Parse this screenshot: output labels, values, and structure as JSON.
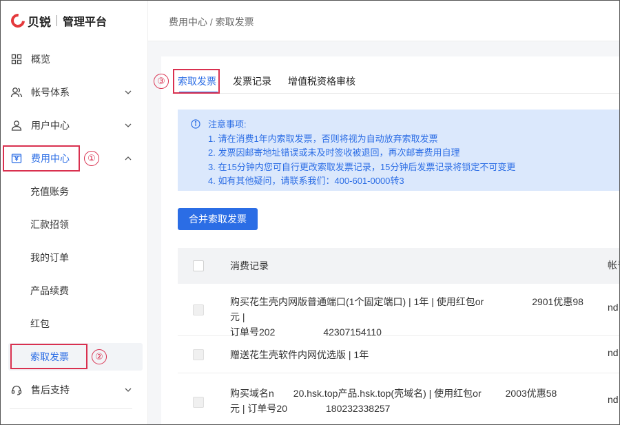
{
  "logo": {
    "brand": "贝锐",
    "title": "管理平台"
  },
  "sidebar": {
    "items": [
      {
        "label": "概览",
        "icon": "grid-icon"
      },
      {
        "label": "帐号体系",
        "icon": "users-icon"
      },
      {
        "label": "用户中心",
        "icon": "user-icon"
      },
      {
        "label": "费用中心",
        "icon": "yen-ledger-icon"
      },
      {
        "label": "售后支持",
        "icon": "headset-icon"
      }
    ],
    "sub_items": [
      "充值账务",
      "汇款招领",
      "我的订单",
      "产品续费",
      "红包",
      "索取发票"
    ]
  },
  "annotations": {
    "one": "①",
    "two": "②",
    "three": "③"
  },
  "breadcrumb": "费用中心 / 索取发票",
  "tabs": [
    "索取发票",
    "发票记录",
    "增值税资格审核"
  ],
  "notice": {
    "title": "注意事项:",
    "lines": [
      "1. 请在消费1年内索取发票，否则将视为自动放弃索取发票",
      "2. 发票因邮寄地址错误或未及时签收被退回，再次邮寄费用自理",
      "3. 在15分钟内您可自行更改索取发票记录，15分钟后发票记录将锁定不可变更",
      "4. 如有其他疑问，请联系我们：400-601-0000转3"
    ]
  },
  "merge_button": "合并索取发票",
  "table": {
    "headers": [
      "消费记录",
      "帐号"
    ],
    "rows": [
      {
        "line1a": "购买花生壳内网版普通端口(1个固定端口) | 1年 | 使用红包or",
        "line1b": "2901优惠98元 |",
        "line2a": "订单号202",
        "line2b": "42307154110",
        "right": "nd"
      },
      {
        "line1a": "赠送花生壳软件内网优选版 | 1年",
        "line1b": "",
        "line2a": "",
        "line2b": "",
        "right": "nd"
      },
      {
        "line1a": "购买域名n",
        "line1b": "20.hsk.top产品.hsk.top(壳域名) | 使用红包or",
        "line1c": "2003优惠58",
        "line2a": "元 | 订单号20",
        "line2b": "180232338257",
        "right": "nd"
      }
    ]
  }
}
